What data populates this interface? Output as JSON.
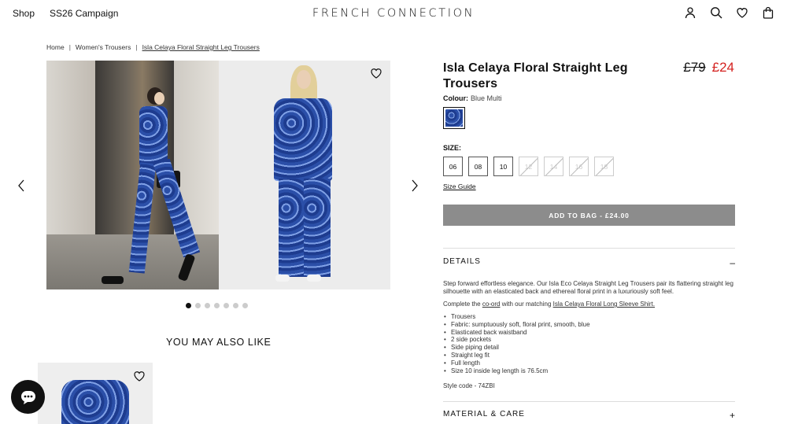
{
  "header": {
    "nav": [
      "Shop",
      "SS26 Campaign"
    ],
    "logo": "FRENCH CONNECTION",
    "icons": [
      "account-icon",
      "search-icon",
      "wishlist-icon",
      "bag-icon"
    ]
  },
  "breadcrumb": {
    "home": "Home",
    "category": "Women's Trousers",
    "current": "Isla Celaya Floral Straight Leg Trousers",
    "separator": "|"
  },
  "gallery": {
    "slide_count": 7,
    "active_slide": 1
  },
  "product": {
    "title": "Isla Celaya Floral Straight Leg Trousers",
    "price_was": "£79",
    "price_now": "£24",
    "colour_label": "Colour:",
    "colour_value": "Blue Multi",
    "size_label": "SIZE:",
    "sizes": [
      {
        "label": "06",
        "available": true
      },
      {
        "label": "08",
        "available": true
      },
      {
        "label": "10",
        "available": true
      },
      {
        "label": "12",
        "available": false
      },
      {
        "label": "14",
        "available": false
      },
      {
        "label": "16",
        "available": false
      },
      {
        "label": "18",
        "available": false
      }
    ],
    "size_guide": "Size Guide",
    "add_to_bag": "ADD TO BAG - £24.00"
  },
  "details": {
    "heading": "DETAILS",
    "toggle": "–",
    "intro": "Step forward effortless elegance. Our Isla Eco Celaya Straight Leg Trousers pair its flattering straight leg silhouette with an elasticated back and ethereal floral print in a luxuriously soft feel.",
    "coord_pre": "Complete the ",
    "coord_link": "co-ord",
    "coord_mid": " with our matching ",
    "coord_shirt": "Isla Celaya Floral Long Sleeve Shirt.",
    "bullets": [
      "Trousers",
      "Fabric: sumptuously soft, floral print, smooth, blue",
      "Elasticated back waistband",
      "2 side pockets",
      "Side piping detail",
      "Straight leg fit",
      "Full length",
      "Size 10 inside leg length is 76.5cm"
    ],
    "style_code": "Style code - 74ZBI"
  },
  "material": {
    "heading": "MATERIAL & CARE",
    "toggle": "+"
  },
  "recommendations": {
    "heading": "YOU MAY ALSO LIKE"
  }
}
